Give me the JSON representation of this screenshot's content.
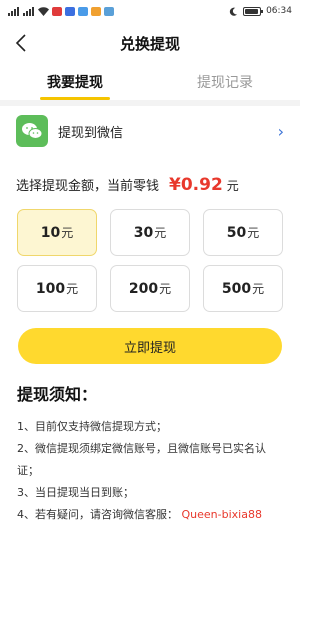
{
  "status_bar": {
    "time": "06:34",
    "moon_icon": "moon-icon",
    "battery_icon": "battery-icon"
  },
  "nav": {
    "title": "兑换提现",
    "back_icon": "chevron-left-icon"
  },
  "tabs": [
    {
      "label": "我要提现",
      "active": true
    },
    {
      "label": "提现记录",
      "active": false
    }
  ],
  "wechat": {
    "label": "提现到微信",
    "icon": "wechat-icon",
    "chevron": "›"
  },
  "amount": {
    "prefix": "选择提现金额，当前零钱",
    "balance": "¥0.92",
    "unit": "元"
  },
  "options": [
    {
      "value": "10",
      "unit": "元",
      "selected": true
    },
    {
      "value": "30",
      "unit": "元",
      "selected": false
    },
    {
      "value": "50",
      "unit": "元",
      "selected": false
    },
    {
      "value": "100",
      "unit": "元",
      "selected": false
    },
    {
      "value": "200",
      "unit": "元",
      "selected": false
    },
    {
      "value": "500",
      "unit": "元",
      "selected": false
    }
  ],
  "submit_label": "立即提现",
  "notice": {
    "title": "提现须知：",
    "items": [
      "1、目前仅支持微信提现方式；",
      "2、微信提现须绑定微信账号，且微信账号已实名认",
      "证；",
      "3、当日提现当日到账；",
      "4、若有疑问，请咨询微信客服："
    ],
    "service_id": "Queen-bixia88"
  },
  "colors": {
    "accent_yellow": "#ffd92e",
    "balance_red": "#e8382c",
    "wechat_green": "#5dbd5a"
  }
}
